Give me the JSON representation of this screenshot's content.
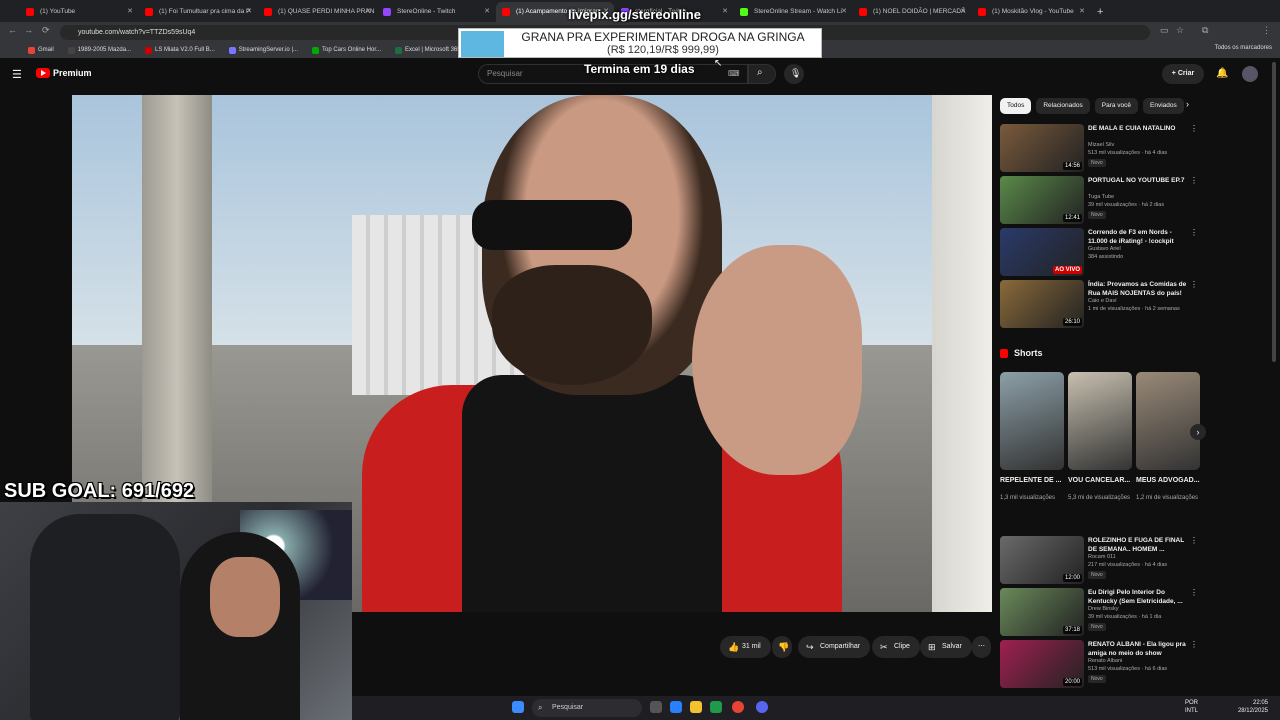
{
  "browser": {
    "tabs": [
      {
        "label": "(1) YouTube",
        "color": "#ff0000",
        "active": false
      },
      {
        "label": "(1) Foi Tumultuar pra cima da P",
        "color": "#ff0000",
        "active": false
      },
      {
        "label": "(1) QUASE PERDI MINHA PRAN",
        "color": "#ff0000",
        "active": false
      },
      {
        "label": "StereOnline - Twitch",
        "color": "#9146ff",
        "active": false
      },
      {
        "label": "(1) Acampamento de imigran",
        "color": "#ff0000",
        "active": true
      },
      {
        "label": "steroficial - Twitch",
        "color": "#9146ff",
        "active": false
      },
      {
        "label": "StereOnline Stream - Watch Li",
        "color": "#53fc18",
        "active": false
      },
      {
        "label": "(1) NOEL DOIDÃO | MERCADÃ",
        "color": "#ff0000",
        "active": false
      },
      {
        "label": "(1) Moskitão Vlog - YouTube",
        "color": "#ff0000",
        "active": false
      }
    ],
    "url": "youtube.com/watch?v=TTZDs59sUq4",
    "bookmarks": [
      {
        "label": "Gmail",
        "color": "#ea4335"
      },
      {
        "label": "1989-2005 Mazda...",
        "color": "#444"
      },
      {
        "label": "LS Miata V2.0 Full B...",
        "color": "#c00"
      },
      {
        "label": "StreamingServer.io |...",
        "color": "#77f"
      },
      {
        "label": "Top Cars Online Hor...",
        "color": "#0a0"
      },
      {
        "label": "Excel | Microsoft 365",
        "color": "#1d6f42"
      }
    ],
    "bookmarks_right": "Todos os marcadores"
  },
  "youtube": {
    "logo": "Premium",
    "search_placeholder": "Pesquisar",
    "create_label": "Criar"
  },
  "overlay": {
    "livepix": "livepix.gg/stereonline",
    "donation_line1": "GRANA PRA EXPERIMENTAR DROGA NA GRINGA",
    "donation_line2": "(R$ 120,19/R$ 999,99)",
    "donation_progress": 0.12,
    "ends_in": "Termina em 19 dias",
    "sub_goal": "SUB GOAL: 691/692"
  },
  "actions": {
    "likes": "31 mil",
    "share": "Compartilhar",
    "clip": "Clipe",
    "save": "Salvar"
  },
  "sidebar": {
    "chips": [
      "Todos",
      "Relacionados",
      "Para você",
      "Enviados"
    ],
    "recs": [
      {
        "title": "DE MALA E CUIA NATALINO",
        "channel": "Mizael Silv",
        "meta": "513 mil visualizações · há 4 dias",
        "badge": "Novo",
        "duration": "14:56",
        "thumb": "#7a5a3c"
      },
      {
        "title": "PORTUGAL NO YOUTUBE EP.7",
        "channel": "Tuga Tube",
        "meta": "39 mil visualizações · há 2 dias",
        "badge": "Novo",
        "duration": "12:41",
        "thumb": "#5a8a4a"
      },
      {
        "title": "Correndo de F3 em Nords - 11.000 de iRating! - !cockpit",
        "channel": "Gustavo Ariel",
        "meta": "384 assistindo",
        "badge": "",
        "duration": "AO VIVO",
        "thumb": "#2a3a6a"
      },
      {
        "title": "Índia: Provamos as Comidas de Rua MAIS NOJENTAS do país!",
        "channel": "Caio e Davi",
        "meta": "1 mi de visualizações · há 2 semanas",
        "badge": "",
        "duration": "26:10",
        "thumb": "#8a6a3a"
      }
    ],
    "shorts_label": "Shorts",
    "shorts": [
      {
        "title": "REPELENTE DE ...",
        "views": "1,3 mil visualizações",
        "thumb": "#8ca0a8"
      },
      {
        "title": "VOU CANCELAR...",
        "views": "5,3 mi de visualizações",
        "thumb": "#c8c0b0"
      },
      {
        "title": "MEUS ADVOGAD...",
        "views": "1,2 mi de visualizações",
        "thumb": "#9a8a78"
      }
    ],
    "recs2": [
      {
        "title": "ROLEZINHO E FUGA DE FINAL DE SEMANA.. HOMEM ...",
        "channel": "Rocam 011",
        "meta": "217 mil visualizações · há 4 dias",
        "badge": "Novo",
        "duration": "12:00",
        "thumb": "#6a6a6a"
      },
      {
        "title": "Eu Dirigi Pelo Interior Do Kentucky (Sem Eletricidade, ...",
        "channel": "Drew Binsky",
        "meta": "39 mil visualizações · há 1 dia",
        "badge": "Novo",
        "duration": "37:18",
        "thumb": "#6a8a5a"
      },
      {
        "title": "RENATO ALBANI - Ela ligou pra amiga no meio do show",
        "channel": "Renato Albani",
        "meta": "513 mil visualizações · há 6 dias",
        "badge": "Novo",
        "duration": "20:00",
        "thumb": "#a02050"
      }
    ]
  },
  "taskbar": {
    "search": "Pesquisar",
    "lang1": "POR",
    "lang2": "INTL",
    "time": "22:05",
    "date": "28/12/2025"
  }
}
